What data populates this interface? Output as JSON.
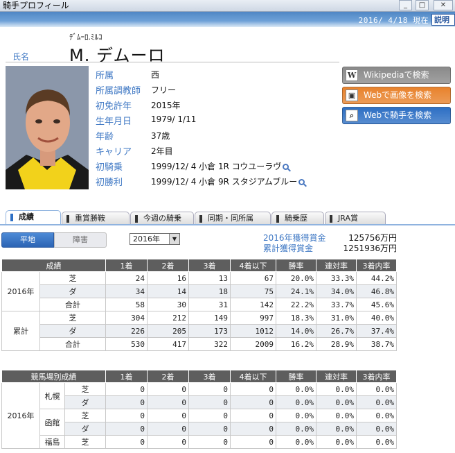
{
  "window": {
    "title": "騎手プロフィール",
    "btn_min": "_",
    "btn_max": "□",
    "btn_close": "✕"
  },
  "header": {
    "date": "2016/ 4/18 現在",
    "notice": "説明"
  },
  "jockey": {
    "name_label": "氏名",
    "furigana": "ﾃﾞﾑｰﾛ.ﾐﾙｺ",
    "name": "M. デムーロ"
  },
  "profile": [
    {
      "label": "所属",
      "value": "西"
    },
    {
      "label": "所属調教師",
      "value": "フリー"
    },
    {
      "label": "初免許年",
      "value": "2015年"
    },
    {
      "label": "生年月日",
      "value": "1979/ 1/11"
    },
    {
      "label": "年齢",
      "value": "37歳"
    },
    {
      "label": "キャリア",
      "value": "2年目"
    },
    {
      "label": "初騎乗",
      "value": "1999/12/ 4 小倉 1R コウユーラヴ"
    },
    {
      "label": "初勝利",
      "value": "1999/12/ 4 小倉 9R スタジアムブルー"
    }
  ],
  "side_buttons": [
    {
      "label": "Wikipediaで検索",
      "icon": "wikipedia-icon",
      "glyph": "W",
      "color": "#8a8a8a"
    },
    {
      "label": "Webで画像を検索",
      "icon": "image-search-icon",
      "glyph": "▣",
      "color": "#e8822c"
    },
    {
      "label": "Webで騎手を検索",
      "icon": "web-search-icon",
      "glyph": "⌕",
      "color": "#2d6fc4"
    }
  ],
  "tabs": [
    "成績",
    "重賞勝鞍",
    "今週の騎乗",
    "同期・同所属",
    "騎乗歴",
    "JRA賞"
  ],
  "toggle": {
    "on": "平地",
    "off": "障害"
  },
  "year_select": "2016年",
  "earnings": [
    {
      "label": "2016年獲得賞金",
      "value": "125756万円"
    },
    {
      "label": "累計獲得賞金",
      "value": "1251936万円"
    }
  ],
  "results_table": {
    "headers": [
      "成績",
      "1着",
      "2着",
      "3着",
      "4着以下",
      "勝率",
      "連対率",
      "3着内率"
    ],
    "groups": [
      {
        "label": "2016年",
        "rows": [
          [
            "芝",
            "24",
            "16",
            "13",
            "67",
            "20.0%",
            "33.3%",
            "44.2%"
          ],
          [
            "ダ",
            "34",
            "14",
            "18",
            "75",
            "24.1%",
            "34.0%",
            "46.8%"
          ],
          [
            "合計",
            "58",
            "30",
            "31",
            "142",
            "22.2%",
            "33.7%",
            "45.6%"
          ]
        ]
      },
      {
        "label": "累計",
        "rows": [
          [
            "芝",
            "304",
            "212",
            "149",
            "997",
            "18.3%",
            "31.0%",
            "40.0%"
          ],
          [
            "ダ",
            "226",
            "205",
            "173",
            "1012",
            "14.0%",
            "26.7%",
            "37.4%"
          ],
          [
            "合計",
            "530",
            "417",
            "322",
            "2009",
            "16.2%",
            "28.9%",
            "38.7%"
          ]
        ]
      }
    ]
  },
  "course_table": {
    "headers": [
      "競馬場別成績",
      "1着",
      "2着",
      "3着",
      "4着以下",
      "勝率",
      "連対率",
      "3着内率"
    ],
    "year": "2016年",
    "courses": [
      {
        "name": "札幌",
        "rows": [
          [
            "芝",
            "0",
            "0",
            "0",
            "0",
            "0.0%",
            "0.0%",
            "0.0%"
          ],
          [
            "ダ",
            "0",
            "0",
            "0",
            "0",
            "0.0%",
            "0.0%",
            "0.0%"
          ]
        ]
      },
      {
        "name": "函館",
        "rows": [
          [
            "芝",
            "0",
            "0",
            "0",
            "0",
            "0.0%",
            "0.0%",
            "0.0%"
          ],
          [
            "ダ",
            "0",
            "0",
            "0",
            "0",
            "0.0%",
            "0.0%",
            "0.0%"
          ]
        ]
      },
      {
        "name": "福島",
        "rows": [
          [
            "芝",
            "0",
            "0",
            "0",
            "0",
            "0.0%",
            "0.0%",
            "0.0%"
          ]
        ]
      }
    ]
  }
}
